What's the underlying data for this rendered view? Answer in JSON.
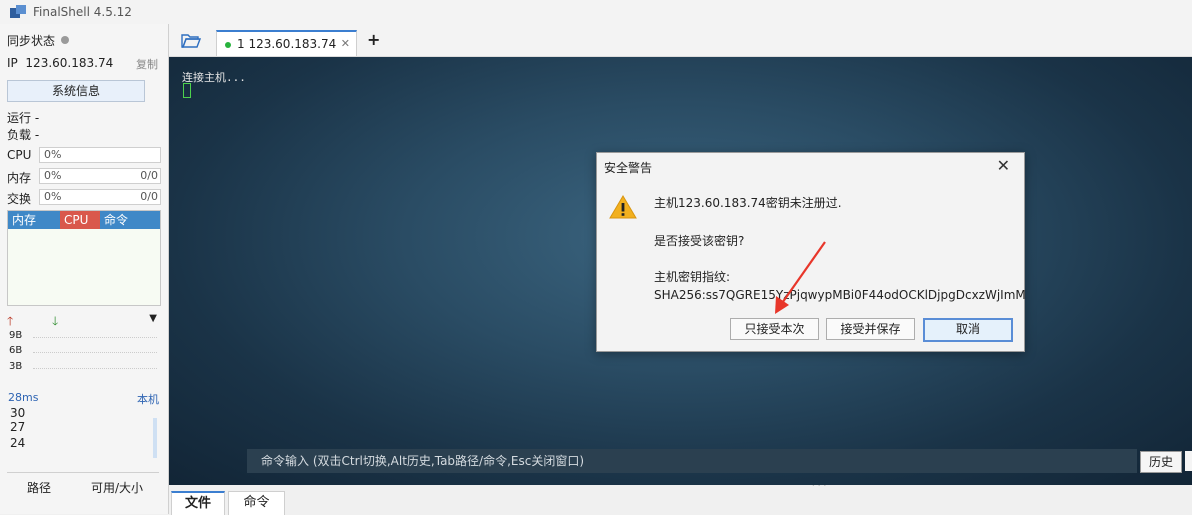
{
  "window": {
    "title": "FinalShell 4.5.12"
  },
  "sidebar": {
    "sync_label": "同步状态",
    "ip_label": "IP",
    "ip_value": "123.60.183.74",
    "copy_label": "复制",
    "sysinfo_button": "系统信息",
    "run_label": "运行 -",
    "load_label": "负载 -",
    "cpu": {
      "label": "CPU",
      "value": "0%"
    },
    "mem": {
      "label": "内存",
      "value": "0%",
      "amount": "0/0"
    },
    "swap": {
      "label": "交换",
      "value": "0%",
      "amount": "0/0"
    },
    "proc_columns": [
      "内存",
      "CPU",
      "命令"
    ],
    "net_ticks": [
      "9B",
      "6B",
      "3B"
    ],
    "ping": {
      "latency": "28ms",
      "target": "本机",
      "ticks": [
        "30",
        "27",
        "24"
      ]
    },
    "bottom_tabs": [
      "路径",
      "可用/大小"
    ]
  },
  "tabs": [
    {
      "label": "1 123.60.183.74"
    }
  ],
  "terminal": {
    "text": "连接主机...",
    "command_placeholder": "命令输入 (双击Ctrl切换,Alt历史,Tab路径/命令,Esc关闭窗口)",
    "history_button": "历史"
  },
  "bottom_panel": {
    "tabs": [
      "文件",
      "命令"
    ]
  },
  "dialog": {
    "title": "安全警告",
    "line1": "主机123.60.183.74密钥未注册过.",
    "line2": "是否接受该密钥?",
    "line3": "主机密钥指纹:",
    "line4": "SHA256:ss7QGRE15YzPjqwypMBi0F44odOCKlDjpgDcxzWjImM",
    "buttons": {
      "accept_once": "只接受本次",
      "accept_save": "接受并保存",
      "cancel": "取消"
    }
  },
  "colors": {
    "accent": "#3b7ed0",
    "connected": "#28b33d",
    "warning": "#f2b01e",
    "annotation_arrow": "#e8362a"
  }
}
